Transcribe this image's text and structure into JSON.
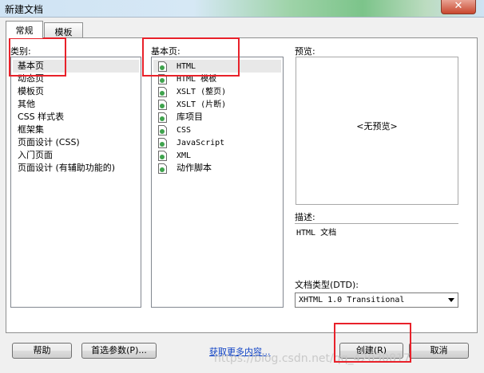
{
  "window": {
    "title": "新建文档",
    "close_label": "✕"
  },
  "tabs": [
    {
      "label": "常规"
    },
    {
      "label": "模板"
    }
  ],
  "category": {
    "label": "类别:",
    "items": [
      "基本页",
      "动态页",
      "模板页",
      "其他",
      "CSS 样式表",
      "框架集",
      "页面设计 (CSS)",
      "入门页面",
      "页面设计 (有辅助功能的)"
    ],
    "selected_index": 0
  },
  "basic_page": {
    "label": "基本页:",
    "items": [
      "HTML",
      "HTML 模板",
      "XSLT (整页)",
      "XSLT (片断)",
      "库项目",
      "CSS",
      "JavaScript",
      "XML",
      "动作脚本"
    ],
    "selected_index": 0
  },
  "preview": {
    "label": "预览:",
    "placeholder": "<无预览>"
  },
  "description": {
    "label": "描述:",
    "text": "HTML 文档"
  },
  "doctype": {
    "label": "文档类型(DTD):",
    "value": "XHTML 1.0 Transitional"
  },
  "buttons": {
    "help": "帮助",
    "preferences": "首选参数(P)...",
    "more_content": "获取更多内容...",
    "create": "创建(R)",
    "cancel": "取消"
  },
  "watermark": "https://blog.csdn.net/qq_42030817"
}
